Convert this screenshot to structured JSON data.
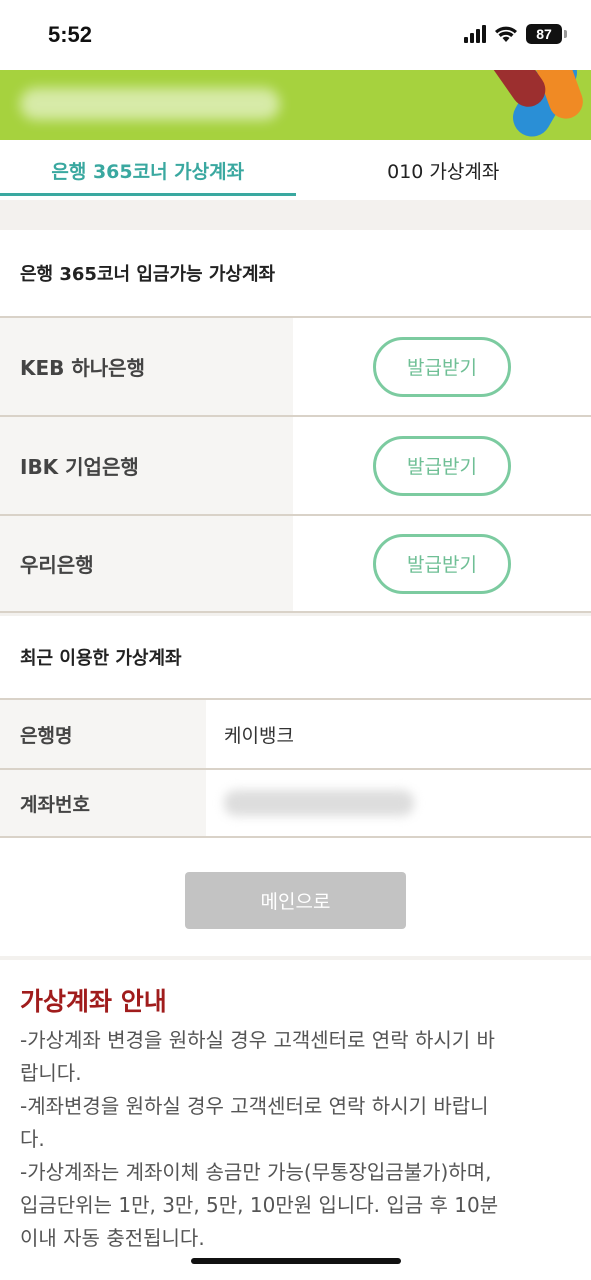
{
  "status_bar": {
    "time": "5:52",
    "battery": "87"
  },
  "tabs": [
    {
      "label": "은행 365코너 가상계좌",
      "active": true
    },
    {
      "label": "010 가상계좌",
      "active": false
    }
  ],
  "bank_section": {
    "title": "은행 365코너 입금가능 가상계좌",
    "rows": [
      {
        "bank": "KEB 하나은행",
        "button": "발급받기"
      },
      {
        "bank": "IBK 기업은행",
        "button": "발급받기"
      },
      {
        "bank": "우리은행",
        "button": "발급받기"
      }
    ]
  },
  "recent_section": {
    "title": "최근 이용한 가상계좌",
    "bank_label": "은행명",
    "bank_value": "케이뱅크",
    "account_label": "계좌번호"
  },
  "main_button": "메인으로",
  "guide": {
    "title": "가상계좌 안내",
    "lines": [
      "-가상계좌 변경을 원하실 경우 고객센터로 연락 하시기 바",
      "랍니다.",
      "-계좌변경을 원하실 경우 고객센터로 연락 하시기 바랍니",
      "다.",
      "-가상계좌는 계좌이체 송금만 가능(무통장입금불가)하며,",
      "입금단위는 1만, 3만, 5만, 10만원 입니다. 입금 후 10분",
      "이내 자동 충전됩니다."
    ]
  },
  "colors": {
    "accent": "#3aa8a0",
    "banner": "#a6d23e",
    "button_border": "#7ccba0",
    "guide_title": "#a01c1c"
  }
}
